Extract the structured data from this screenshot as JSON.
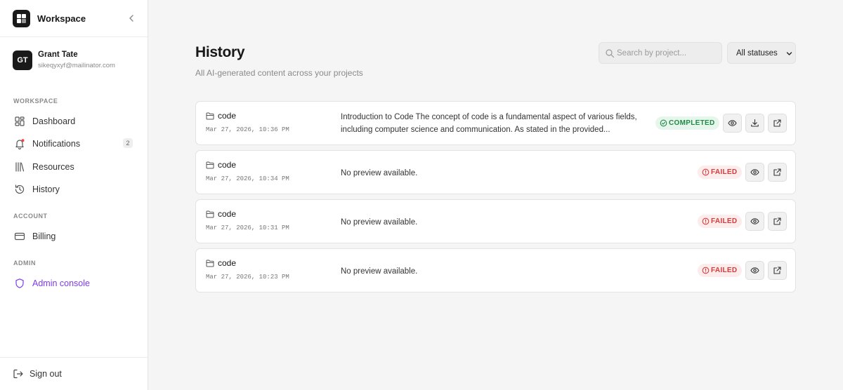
{
  "workspace": {
    "title": "Workspace"
  },
  "user": {
    "initials": "GT",
    "name": "Grant Tate",
    "email": "sikeqyxyf@mailinator.com"
  },
  "sidebar": {
    "sections": [
      {
        "label": "WORKSPACE"
      },
      {
        "label": "ACCOUNT"
      },
      {
        "label": "ADMIN"
      }
    ],
    "items": [
      {
        "label": "Dashboard",
        "icon": "dashboard-icon"
      },
      {
        "label": "Notifications",
        "icon": "bell-icon",
        "badge": "2"
      },
      {
        "label": "Resources",
        "icon": "library-icon"
      },
      {
        "label": "History",
        "icon": "history-icon"
      },
      {
        "label": "Billing",
        "icon": "credit-card-icon"
      },
      {
        "label": "Admin console",
        "icon": "shield-icon"
      }
    ],
    "signout": "Sign out"
  },
  "page": {
    "title": "History",
    "subtitle": "All AI-generated content across your projects"
  },
  "filters": {
    "search_placeholder": "Search by project...",
    "status_value": "All statuses"
  },
  "records": [
    {
      "project": "code",
      "date": "Mar 27, 2026, 10:36 PM",
      "preview": "Introduction to Code The concept of code is a fundamental aspect of various fields, including computer science and communication. As stated in the provided...",
      "status": "COMPLETED"
    },
    {
      "project": "code",
      "date": "Mar 27, 2026, 10:34 PM",
      "preview": "No preview available.",
      "status": "FAILED"
    },
    {
      "project": "code",
      "date": "Mar 27, 2026, 10:31 PM",
      "preview": "No preview available.",
      "status": "FAILED"
    },
    {
      "project": "code",
      "date": "Mar 27, 2026, 10:23 PM",
      "preview": "No preview available.",
      "status": "FAILED"
    }
  ],
  "colors": {
    "accent_admin": "#7c3aed",
    "completed": "#1f8a45",
    "failed": "#d83a3a",
    "notification_dot": "#ef4444"
  }
}
